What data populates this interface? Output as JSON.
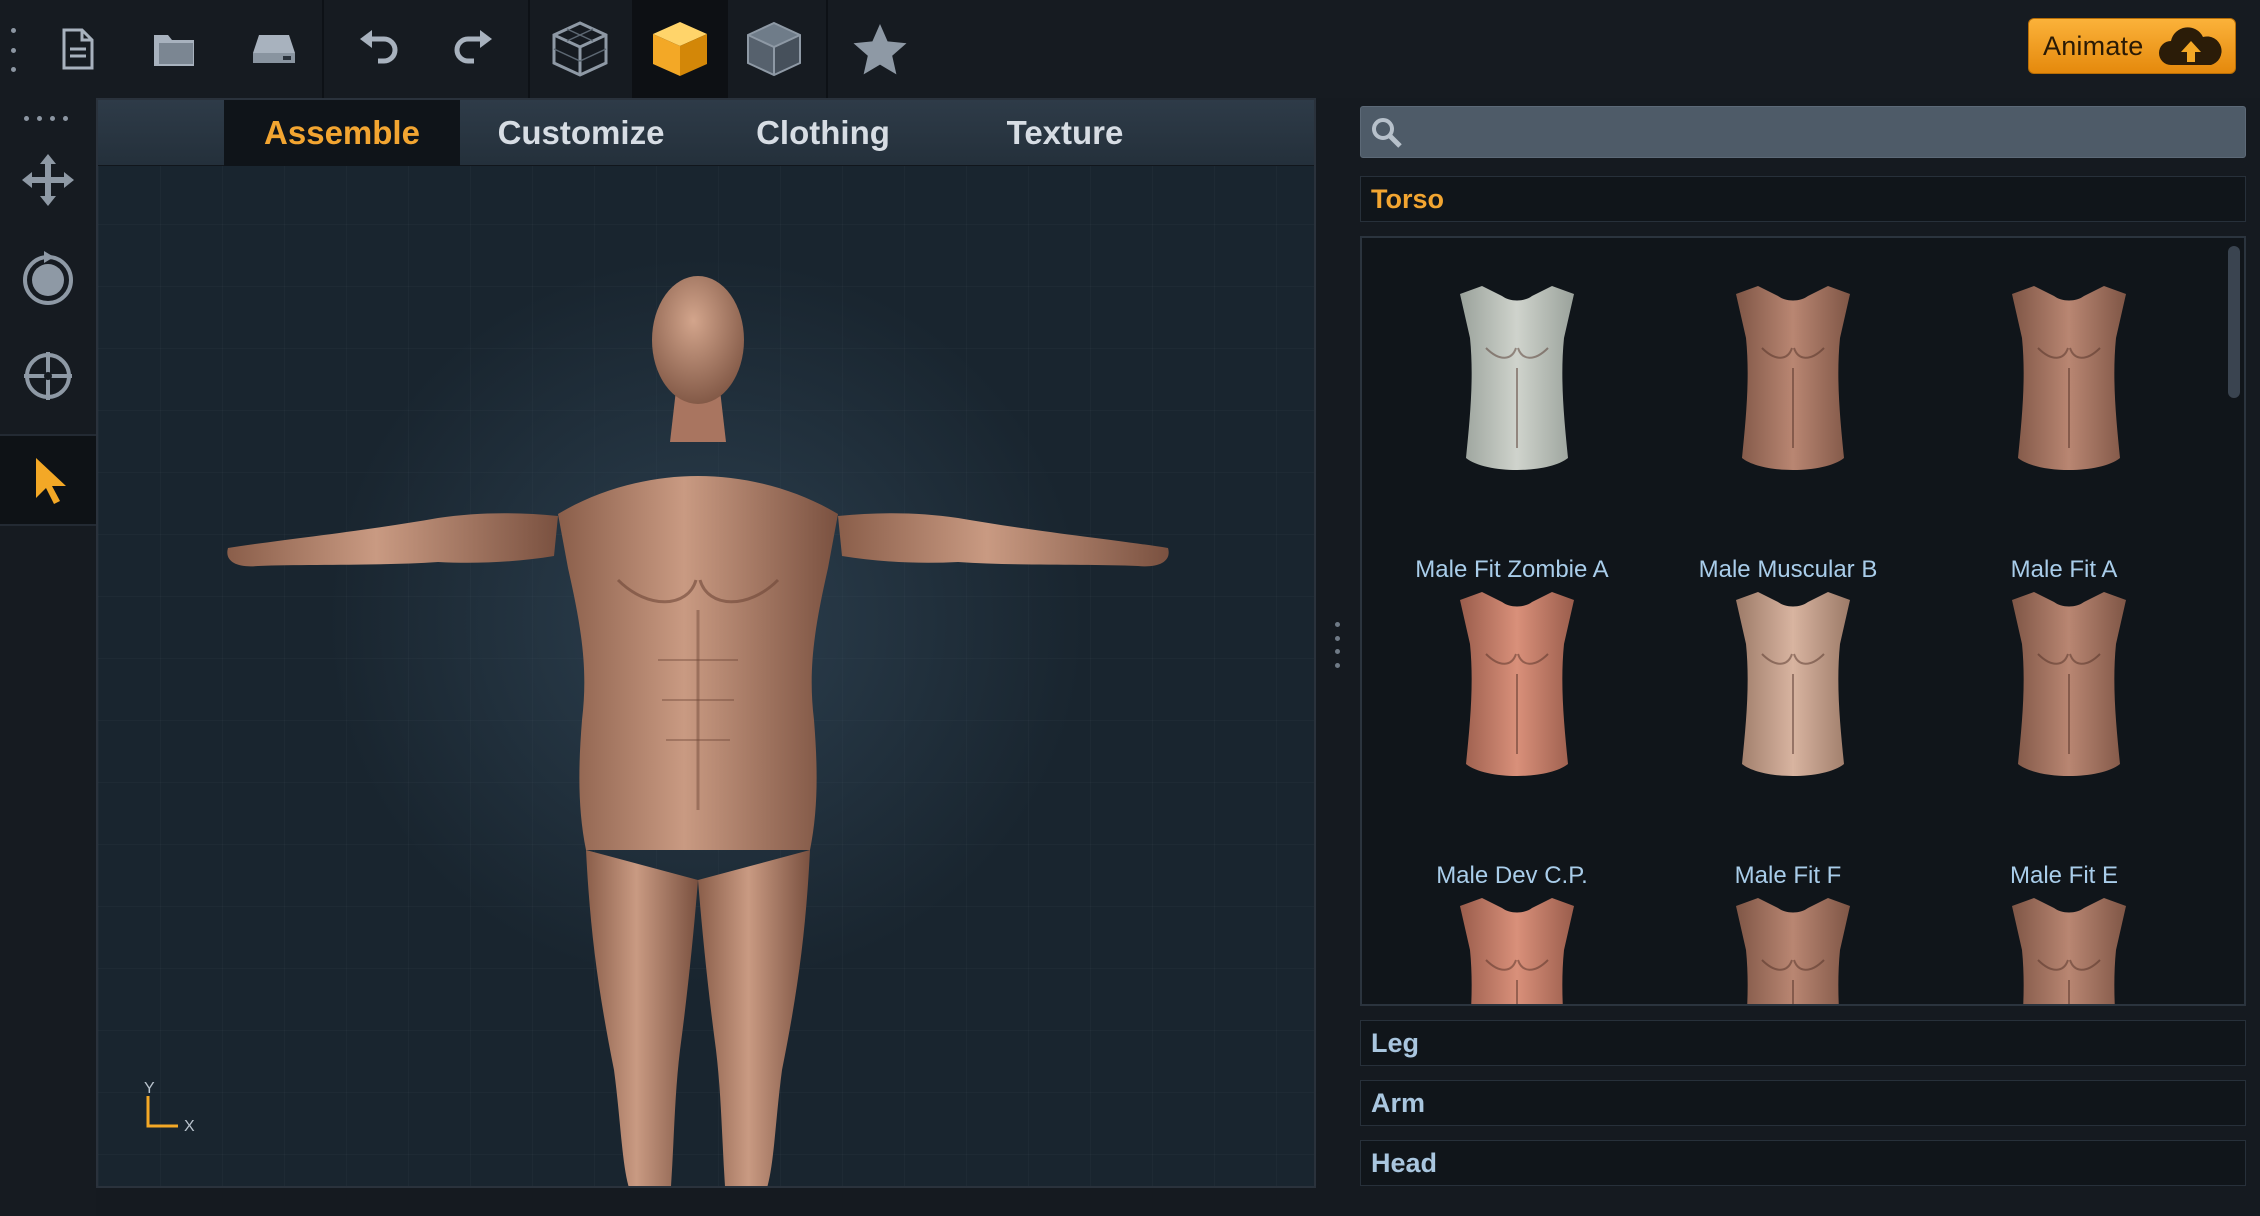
{
  "toolbar": {
    "items": [
      {
        "name": "new-document"
      },
      {
        "name": "open-folder"
      },
      {
        "name": "save-drive"
      },
      {
        "name": "undo"
      },
      {
        "name": "redo"
      },
      {
        "name": "wireframe-cube"
      },
      {
        "name": "solid-cube",
        "active": true
      },
      {
        "name": "shaded-cube"
      },
      {
        "name": "favorites-star"
      }
    ],
    "animate_label": "Animate",
    "accent_color": "#f2a531"
  },
  "left_tools": [
    {
      "name": "move-tool"
    },
    {
      "name": "rotate-tool"
    },
    {
      "name": "target-tool"
    },
    {
      "name": "select-tool",
      "active": true
    }
  ],
  "viewport": {
    "tabs": [
      {
        "label": "Assemble",
        "active": true
      },
      {
        "label": "Customize"
      },
      {
        "label": "Clothing"
      },
      {
        "label": "Texture"
      }
    ],
    "axis": {
      "y": "Y",
      "x": "X"
    }
  },
  "library": {
    "search": {
      "value": "",
      "placeholder": ""
    },
    "open_category": "Torso",
    "items": [
      {
        "label": "Male Fit Zombie A",
        "tone": "zombie"
      },
      {
        "label": "Male Muscular B",
        "tone": "tan"
      },
      {
        "label": "Male Fit A",
        "tone": "tan"
      },
      {
        "label": "Male Dev C.P.",
        "tone": "pink"
      },
      {
        "label": "Male Fit F",
        "tone": "pale"
      },
      {
        "label": "Male Fit E",
        "tone": "tan"
      },
      {
        "label": "",
        "tone": "pink"
      },
      {
        "label": "",
        "tone": "tan"
      },
      {
        "label": "",
        "tone": "tan"
      }
    ],
    "collapsed_categories": [
      "Leg",
      "Arm",
      "Head"
    ]
  }
}
